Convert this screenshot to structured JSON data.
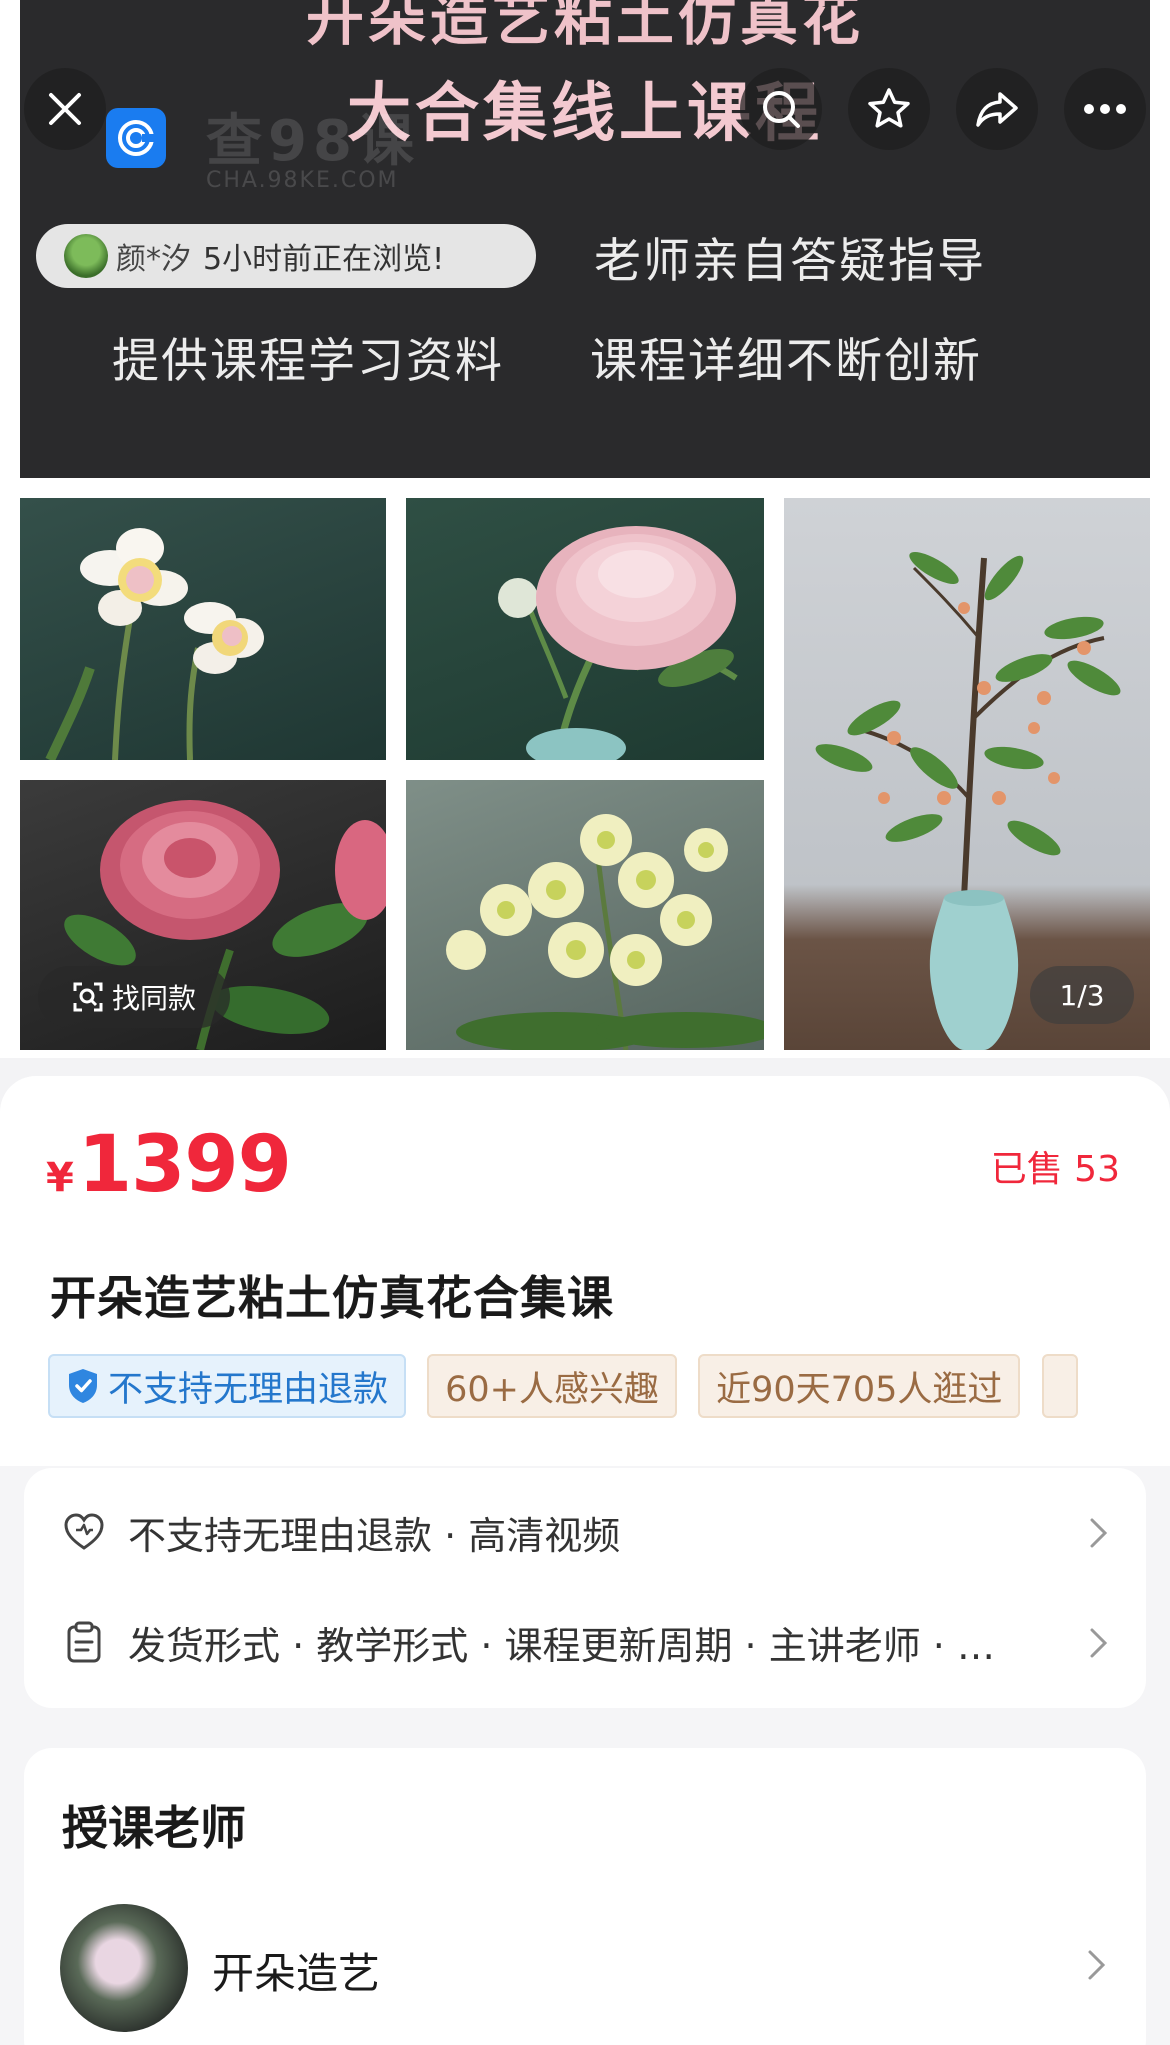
{
  "banner": {
    "headline_line1": "开朵造艺粘土仿真花",
    "headline_line2": "大合集线上课程",
    "features": [
      "老师亲自答疑指导",
      "提供课程学习资料",
      "课程详细不断创新"
    ],
    "watermark_logo": "查98课",
    "watermark_sub": "CHA.98KE.COM",
    "viewer": {
      "name": "颜*汐",
      "text": "5小时前正在浏览!"
    }
  },
  "top_actions": {
    "close_icon": "close-icon",
    "search_icon": "search-icon",
    "star_icon": "star-icon",
    "share_icon": "share-icon",
    "more_icon": "more-icon"
  },
  "gallery": {
    "find_same_label": "找同款",
    "page_indicator": "1/3"
  },
  "product": {
    "currency": "¥",
    "price": "1399",
    "sold": "已售 53",
    "title": "开朵造艺粘土仿真花合集课",
    "tags": [
      "不支持无理由退款",
      "60+人感兴趣",
      "近90天705人逛过"
    ]
  },
  "services": {
    "row1": "不支持无理由退款 · 高清视频",
    "row2": "发货形式 · 教学形式 · 课程更新周期 · 主讲老师 · …"
  },
  "teacher": {
    "section_title": "授课老师",
    "name": "开朵造艺"
  },
  "colors": {
    "price_red": "#f0273b",
    "refund_blue": "#2477cc",
    "tag_gold": "#9a6b43"
  }
}
